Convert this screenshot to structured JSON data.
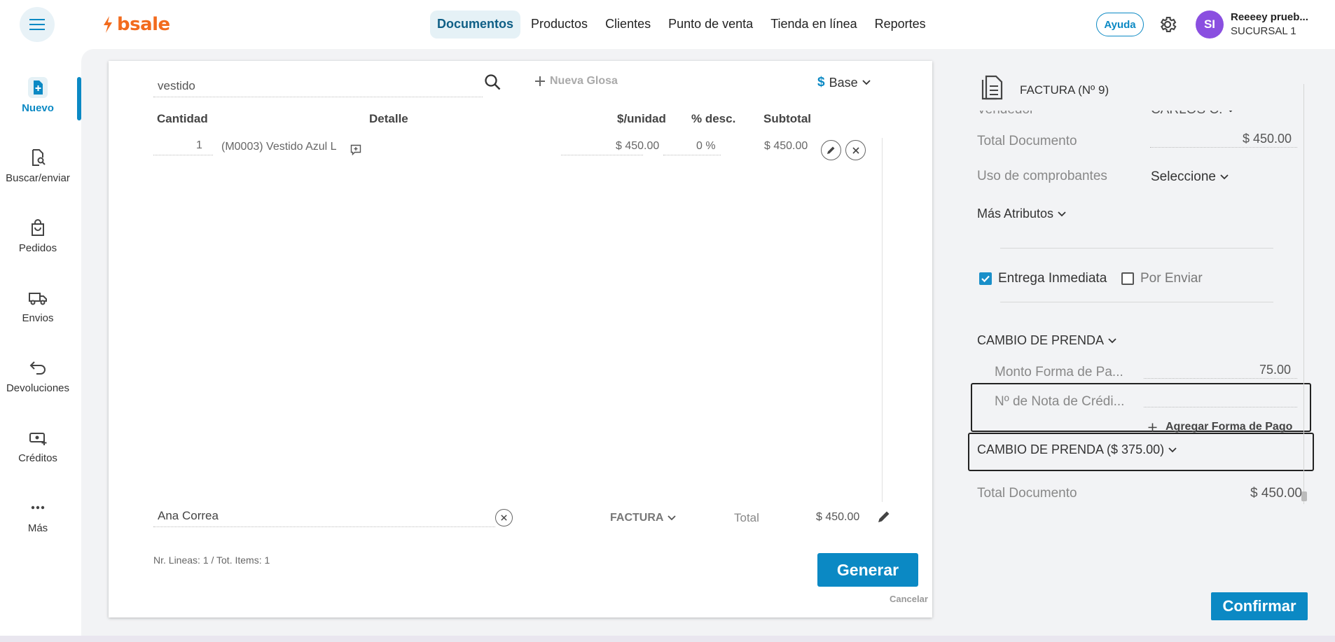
{
  "app": {
    "logo_text": "bsale",
    "brand_color": "#f26b1d",
    "accent_color": "#0b89c4"
  },
  "topnav": {
    "items": [
      {
        "label": "Documentos",
        "active": true
      },
      {
        "label": "Productos",
        "active": false
      },
      {
        "label": "Clientes",
        "active": false
      },
      {
        "label": "Punto de venta",
        "active": false
      },
      {
        "label": "Tienda en línea",
        "active": false
      },
      {
        "label": "Reportes",
        "active": false
      }
    ],
    "help_label": "Ayuda",
    "user": {
      "initials": "SI",
      "name": "Reeeey prueb...",
      "branch": "SUCURSAL 1"
    }
  },
  "sidebar": {
    "items": [
      {
        "label": "Nuevo",
        "icon": "new-document-icon",
        "active": true
      },
      {
        "label": "Buscar/enviar",
        "icon": "search-document-icon",
        "active": false
      },
      {
        "label": "Pedidos",
        "icon": "shopping-bag-icon",
        "active": false
      },
      {
        "label": "Envios",
        "icon": "truck-icon",
        "active": false
      },
      {
        "label": "Devoluciones",
        "icon": "return-arrow-icon",
        "active": false
      },
      {
        "label": "Créditos",
        "icon": "money-plus-icon",
        "active": false
      },
      {
        "label": "Más",
        "icon": "more-dots-icon",
        "active": false
      }
    ]
  },
  "document": {
    "search_value": "vestido",
    "new_glosa_label": "Nueva Glosa",
    "currency_symbol": "$",
    "price_list_label": "Base",
    "columns": {
      "quantity": "Cantidad",
      "detail": "Detalle",
      "unit_price": "$/unidad",
      "discount": "% desc.",
      "subtotal": "Subtotal"
    },
    "lines": [
      {
        "quantity": "1",
        "detail": "(M0003) Vestido Azul L",
        "unit_price": "$ 450.00",
        "discount": "0 %",
        "subtotal": "$ 450.00"
      }
    ],
    "client_value": "Ana Correa",
    "doc_type_label": "FACTURA",
    "total_label": "Total",
    "total_value": "$ 450.00",
    "lines_info": "Nr. Lineas: 1 / Tot. Items: 1",
    "generate_label": "Generar",
    "cancel_label": "Cancelar"
  },
  "panel": {
    "doc_title": "FACTURA (Nº 9)",
    "vendor_label": "Vendedor",
    "vendor_value": "CARLOS C.",
    "total_doc_label": "Total Documento",
    "total_doc_value": "$ 450.00",
    "uso_label": "Uso de comprobantes",
    "uso_value": "Seleccione",
    "more_attrs_label": "Más Atributos",
    "entrega_inmediata": {
      "label": "Entrega Inmediata",
      "checked": true
    },
    "por_enviar": {
      "label": "Por Enviar",
      "checked": false
    },
    "payment_section_label": "CAMBIO DE PRENDA",
    "payment_amount_label": "Monto Forma de Pa...",
    "payment_amount_value": "75.00",
    "credit_note_label": "Nº de Nota de Crédi...",
    "credit_note_value": "",
    "add_payment_label": "Agregar Forma de Pago",
    "payment_summary_label": "CAMBIO DE PRENDA ($ 375.00)",
    "total_bottom_label": "Total Documento",
    "total_bottom_value": "$ 450.00",
    "confirm_label": "Confirmar"
  }
}
